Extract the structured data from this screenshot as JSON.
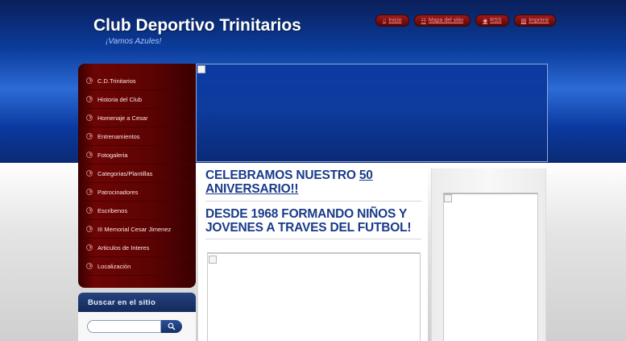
{
  "header": {
    "site_title": "Club Deportivo Trinitarios",
    "slogan": "¡Vamos Azules!"
  },
  "top_links": [
    {
      "label": "Inicio",
      "icon": "home-icon"
    },
    {
      "label": "Mapa del sitio",
      "icon": "sitemap-icon"
    },
    {
      "label": "RSS",
      "icon": "rss-icon"
    },
    {
      "label": "Imprimir",
      "icon": "print-icon"
    }
  ],
  "sidebar": {
    "items": [
      {
        "label": "C.D.Trinitarios"
      },
      {
        "label": "Historia del Club"
      },
      {
        "label": "Homenaje a Cesar"
      },
      {
        "label": "Entrenamientos"
      },
      {
        "label": "Fotogaleria"
      },
      {
        "label": "Categorias/Plantillas"
      },
      {
        "label": "Patrocinadores"
      },
      {
        "label": "Escribenos"
      },
      {
        "label": "III Memorial Cesar Jimenez"
      },
      {
        "label": "Articulos de Interes"
      },
      {
        "label": "Localización"
      }
    ]
  },
  "search": {
    "title": "Buscar en el sitio",
    "placeholder": "",
    "button_icon": "search-icon"
  },
  "content": {
    "headline1_prefix": "CELEBRAMOS NUESTRO ",
    "headline1_link": "50 ANIVERSARIO!!",
    "headline2": "DESDE 1968 FORMANDO NIÑOS Y JOVENES A TRAVES DEL FUTBOL!"
  },
  "colors": {
    "header_blue": "#0b3c9c",
    "menu_red": "#6d0505",
    "headline_blue": "#1a3b8a"
  }
}
